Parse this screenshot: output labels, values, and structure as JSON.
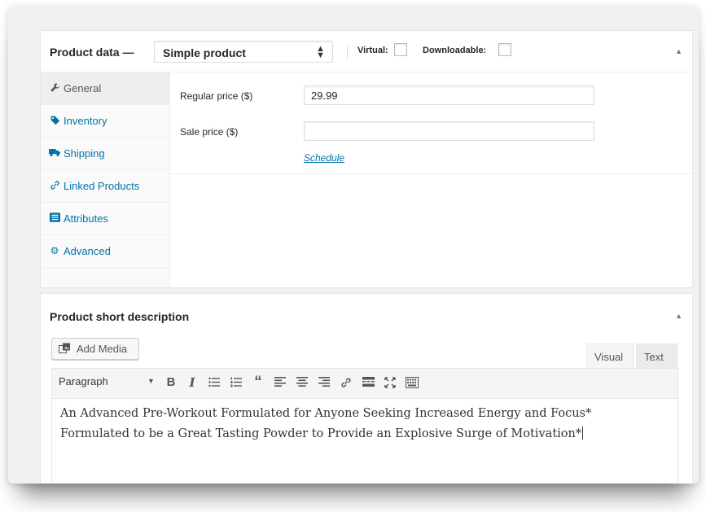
{
  "product_data": {
    "title": "Product data —",
    "product_type": "Simple product",
    "virtual_label": "Virtual:",
    "downloadable_label": "Downloadable:",
    "tabs": [
      {
        "label": "General",
        "icon": "wrench-icon"
      },
      {
        "label": "Inventory",
        "icon": "tag-icon"
      },
      {
        "label": "Shipping",
        "icon": "truck-icon"
      },
      {
        "label": "Linked Products",
        "icon": "link-icon"
      },
      {
        "label": "Attributes",
        "icon": "list-icon"
      },
      {
        "label": "Advanced",
        "icon": "gear-icon"
      }
    ],
    "regular_price_label": "Regular price ($)",
    "regular_price_value": "29.99",
    "sale_price_label": "Sale price ($)",
    "sale_price_value": "",
    "schedule_link": "Schedule"
  },
  "short_description": {
    "title": "Product short description",
    "add_media_label": "Add Media",
    "visual_tab": "Visual",
    "text_tab": "Text",
    "format_select": "Paragraph",
    "content_lines": [
      "An Advanced Pre-Workout Formulated for Anyone Seeking Increased Energy and Focus*",
      "Formulated to be a Great Tasting Powder to Provide an Explosive Surge of Motivation*"
    ]
  },
  "colors": {
    "link": "#0073aa",
    "text": "#23282d"
  }
}
